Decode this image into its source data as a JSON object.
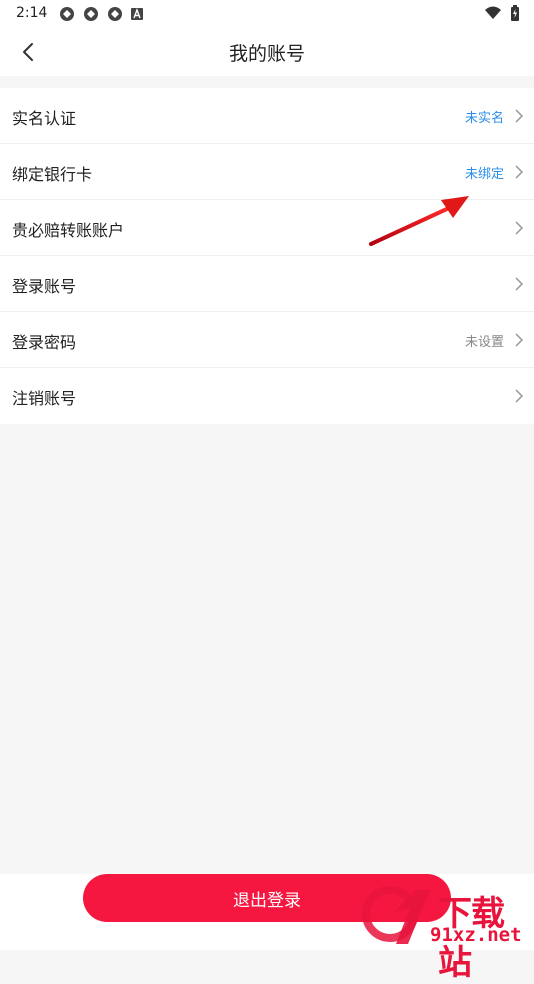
{
  "status_bar": {
    "time": "2:14",
    "icons": [
      "sync-icon",
      "sync-icon",
      "sync-icon",
      "a-badge-icon"
    ],
    "right_icons": [
      "wifi-icon",
      "battery-icon"
    ]
  },
  "header": {
    "back_icon": "chevron-left-icon",
    "title": "我的账号"
  },
  "account_items": [
    {
      "label": "实名认证",
      "value": "未实名",
      "value_color": "#2a8ee8"
    },
    {
      "label": "绑定银行卡",
      "value": "未绑定",
      "value_color": "#2a8ee8"
    },
    {
      "label": "贵必赔转账账户",
      "value": ""
    },
    {
      "label": "登录账号",
      "value": ""
    },
    {
      "label": "登录密码",
      "value": "未设置",
      "value_color": "#888888"
    },
    {
      "label": "注销账号",
      "value": ""
    }
  ],
  "footer": {
    "logout_label": "退出登录",
    "button_color": "#f5173f"
  },
  "watermark": {
    "title": "下载站",
    "site": "91xz.net"
  }
}
